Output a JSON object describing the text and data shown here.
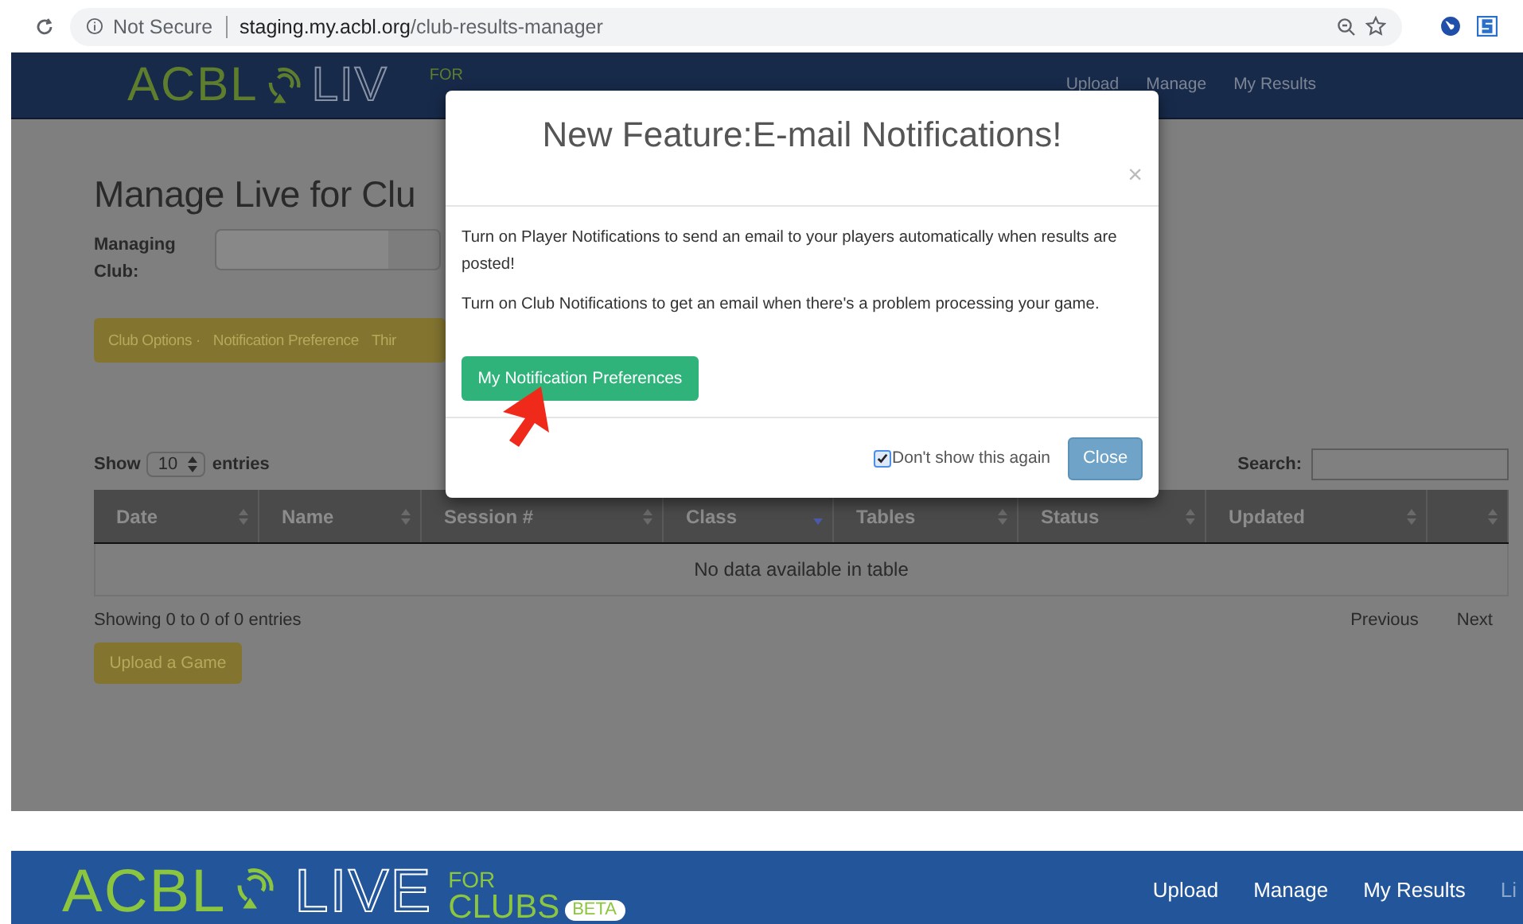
{
  "browser": {
    "security": "Not Secure",
    "url_domain": "staging.my.acbl.org",
    "url_path": "/club-results-manager"
  },
  "page": {
    "header": {
      "logo": {
        "acbl": "ACBL",
        "live": "LIV",
        "for": "FOR"
      },
      "nav": [
        "Upload",
        "Manage",
        "My Results"
      ]
    },
    "title": "Manage Live for Clu",
    "managing_club_label": "Managing Club:",
    "tabs": [
      "Club Options ·",
      "Notification Preference",
      "Thir"
    ],
    "show_label": "Show",
    "page_size": "10",
    "entries_label": "entries",
    "search_label": "Search:",
    "table": {
      "columns": [
        {
          "label": "Date",
          "sorted": false
        },
        {
          "label": "Name",
          "sorted": false
        },
        {
          "label": "Session #",
          "sorted": false
        },
        {
          "label": "Class",
          "sorted": true
        },
        {
          "label": "Tables",
          "sorted": false
        },
        {
          "label": "Status",
          "sorted": false
        },
        {
          "label": "Updated",
          "sorted": false
        },
        {
          "sorted": false
        }
      ],
      "empty": "No data available in table"
    },
    "info": "Showing 0 to 0 of 0 entries",
    "pagination": [
      "Previous",
      "Next"
    ],
    "upload_button": "Upload a Game"
  },
  "modal": {
    "title": "New Feature:E-mail Notifications!",
    "close": "×",
    "paragraphs": [
      "Turn on Player Notifications to send an email to your players automatically when results are posted!",
      "Turn on Club Notifications to get an email when there's a problem processing your game."
    ],
    "primary_button": "My Notification Preferences",
    "dont_show_again": {
      "label": "Don't show this again",
      "checked": true
    },
    "close_button": "Close"
  },
  "bottom_header": {
    "logo": {
      "acbl": "ACBL",
      "live": "LIVE",
      "for": "FOR",
      "clubs": "CLUBS",
      "badge": "BETA"
    },
    "nav": [
      "Upload",
      "Manage",
      "My Results",
      "Li"
    ]
  }
}
